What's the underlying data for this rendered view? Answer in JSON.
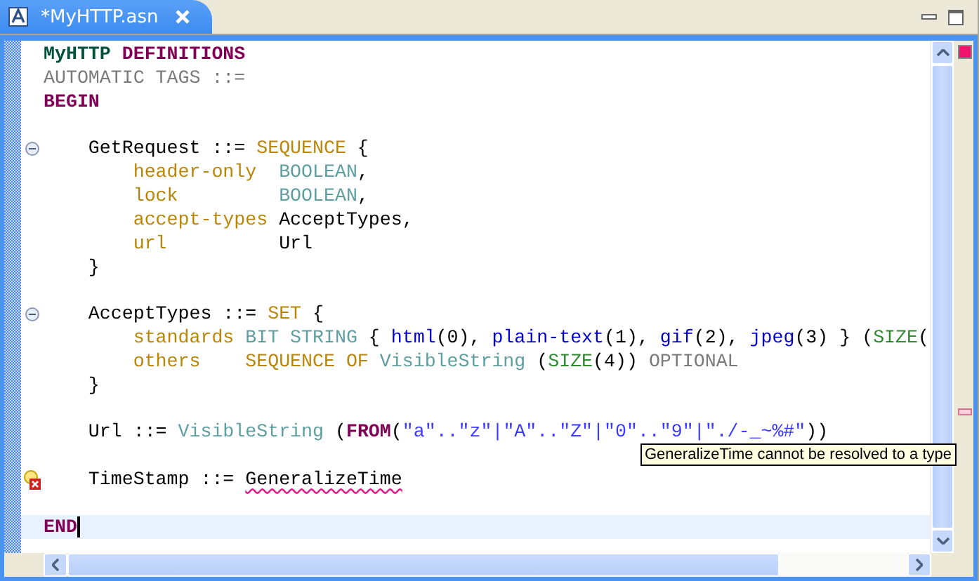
{
  "tab": {
    "title": "*MyHTTP.asn",
    "selected": true
  },
  "lines": [
    {
      "kind": "code",
      "tokens": [
        {
          "kind": "module",
          "text": "MyHTTP"
        },
        {
          "kind": "keyword",
          "text": " DEFINITIONS"
        }
      ]
    },
    {
      "kind": "code",
      "tokens": [
        {
          "kind": "muted",
          "text": "AUTOMATIC TAGS ::="
        }
      ]
    },
    {
      "kind": "code",
      "tokens": [
        {
          "kind": "keyword",
          "text": "BEGIN"
        }
      ]
    },
    {
      "kind": "blank"
    },
    {
      "kind": "code",
      "foldable": true,
      "tokens": [
        {
          "kind": "plain",
          "text": "    GetRequest ::= "
        },
        {
          "kind": "field",
          "text": "SEQUENCE"
        },
        {
          "kind": "plain",
          "text": " {"
        }
      ]
    },
    {
      "kind": "code",
      "tokens": [
        {
          "kind": "field",
          "text": "        header-only"
        },
        {
          "kind": "type",
          "text": "  BOOLEAN"
        },
        {
          "kind": "plain",
          "text": ","
        }
      ]
    },
    {
      "kind": "code",
      "tokens": [
        {
          "kind": "field",
          "text": "        lock"
        },
        {
          "kind": "type",
          "text": "         BOOLEAN"
        },
        {
          "kind": "plain",
          "text": ","
        }
      ]
    },
    {
      "kind": "code",
      "tokens": [
        {
          "kind": "field",
          "text": "        accept-types"
        },
        {
          "kind": "plain",
          "text": " AcceptTypes,"
        }
      ]
    },
    {
      "kind": "code",
      "tokens": [
        {
          "kind": "field",
          "text": "        url"
        },
        {
          "kind": "plain",
          "text": "          Url"
        }
      ]
    },
    {
      "kind": "code",
      "tokens": [
        {
          "kind": "plain",
          "text": "    }"
        }
      ]
    },
    {
      "kind": "blank"
    },
    {
      "kind": "code",
      "foldable": true,
      "tokens": [
        {
          "kind": "plain",
          "text": "    AcceptTypes ::= "
        },
        {
          "kind": "field",
          "text": "SET"
        },
        {
          "kind": "plain",
          "text": " {"
        }
      ]
    },
    {
      "kind": "code",
      "tokens": [
        {
          "kind": "field",
          "text": "        standards"
        },
        {
          "kind": "type",
          "text": " BIT STRING"
        },
        {
          "kind": "plain",
          "text": " { "
        },
        {
          "kind": "named",
          "text": "html"
        },
        {
          "kind": "plain",
          "text": "(0), "
        },
        {
          "kind": "named",
          "text": "plain-text"
        },
        {
          "kind": "plain",
          "text": "(1), "
        },
        {
          "kind": "named",
          "text": "gif"
        },
        {
          "kind": "plain",
          "text": "(2), "
        },
        {
          "kind": "named",
          "text": "jpeg"
        },
        {
          "kind": "plain",
          "text": "(3) } ("
        },
        {
          "kind": "constraint",
          "text": "SIZE"
        },
        {
          "kind": "plain",
          "text": "("
        }
      ]
    },
    {
      "kind": "code",
      "tokens": [
        {
          "kind": "field",
          "text": "        others"
        },
        {
          "kind": "field",
          "text": "    SEQUENCE OF"
        },
        {
          "kind": "type",
          "text": " VisibleString"
        },
        {
          "kind": "plain",
          "text": " ("
        },
        {
          "kind": "constraint",
          "text": "SIZE"
        },
        {
          "kind": "plain",
          "text": "(4)) "
        },
        {
          "kind": "muted",
          "text": "OPTIONAL"
        }
      ]
    },
    {
      "kind": "code",
      "tokens": [
        {
          "kind": "plain",
          "text": "    }"
        }
      ]
    },
    {
      "kind": "blank"
    },
    {
      "kind": "code",
      "tokens": [
        {
          "kind": "plain",
          "text": "    Url ::= "
        },
        {
          "kind": "type",
          "text": "VisibleString"
        },
        {
          "kind": "plain",
          "text": " ("
        },
        {
          "kind": "keyword",
          "text": "FROM"
        },
        {
          "kind": "plain",
          "text": "("
        },
        {
          "kind": "string",
          "text": "\"a\"..\"z\"|\"A\"..\"Z\"|\"0\"..\"9\"|\"./-_~%#\""
        },
        {
          "kind": "plain",
          "text": "))"
        }
      ]
    },
    {
      "kind": "blank"
    },
    {
      "kind": "code",
      "error": true,
      "tokens": [
        {
          "kind": "plain",
          "text": "    TimeStamp ::= "
        },
        {
          "kind": "error",
          "text": "GeneralizeTime"
        }
      ]
    },
    {
      "kind": "blank"
    },
    {
      "kind": "code",
      "current": true,
      "tokens": [
        {
          "kind": "keyword",
          "text": "END"
        }
      ]
    }
  ],
  "tooltip": {
    "text": "GeneralizeTime cannot be resolved to a type"
  }
}
